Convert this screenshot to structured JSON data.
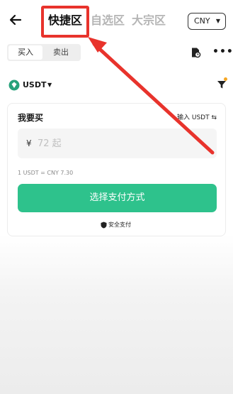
{
  "header": {
    "tabs": [
      {
        "label": "快捷区",
        "active": true
      },
      {
        "label": "自选区",
        "active": false
      },
      {
        "label": "大宗区",
        "active": false
      }
    ],
    "currency": "CNY"
  },
  "trade_toggle": {
    "buy_label": "买入",
    "sell_label": "卖出",
    "selected": "买入"
  },
  "coin_selector": {
    "symbol": "USDT",
    "icon": "usdt-diamond-icon"
  },
  "card": {
    "title": "我要买",
    "switch_label": "输入 USDT ⇆",
    "currency_symbol": "¥",
    "amount_placeholder": "72 起",
    "rate_text": "1 USDT = CNY 7.30",
    "pay_button_label": "选择支付方式",
    "secure_label": "安全支付"
  },
  "colors": {
    "accent_green": "#2ec28c",
    "highlight_red": "#e8332c",
    "filter_dot": "#f5a623"
  }
}
